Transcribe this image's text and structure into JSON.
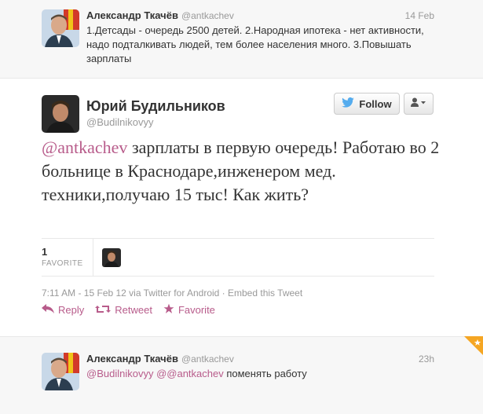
{
  "top_tweet": {
    "fullname": "Александр Ткачёв",
    "handle": "@antkachev",
    "time": "14 Feb",
    "text": "1.Детсады - очередь 2500 детей. 2.Народная ипотека - нет активности, надо подталкивать людей, тем более населения много. 3.Повышать зарплаты"
  },
  "main_tweet": {
    "fullname": "Юрий Будильников",
    "handle": "@Budilnikovyy",
    "follow_label": "Follow",
    "mention": "@antkachev",
    "text": " зарплаты в первую очередь! Работаю во 2 больнице в Краснодаре,инженером мед. техники,получаю 15 тыс! Как жить?",
    "favorite_count": "1",
    "favorite_label": "FAVORITE",
    "meta": "7:11 AM - 15 Feb 12 via Twitter for Android · Embed this Tweet",
    "actions": {
      "reply": "Reply",
      "retweet": "Retweet",
      "favorite": "Favorite"
    }
  },
  "reply_tweet": {
    "fullname": "Александр Ткачёв",
    "handle": "@antkachev",
    "time": "23h",
    "mention1": "@Budilnikovyy",
    "mention2": "@@antkachev",
    "text": " поменять работу"
  },
  "colors": {
    "link": "#b85c8b",
    "muted": "#999999",
    "twitter_bird": "#55acee",
    "corner": "#f5a623"
  },
  "icons": [
    "twitter-bird-icon",
    "user-dropdown-icon",
    "reply-icon",
    "retweet-icon",
    "star-icon"
  ]
}
